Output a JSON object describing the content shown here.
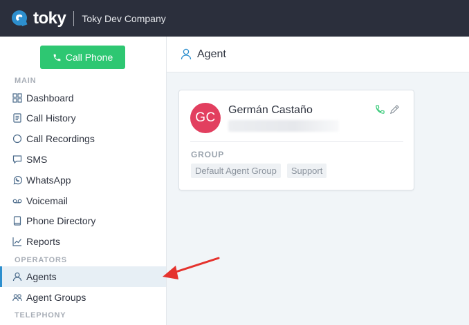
{
  "topbar": {
    "logo_text": "toky",
    "company": "Toky Dev Company"
  },
  "sidebar": {
    "call_button": "Call Phone",
    "sections": {
      "main": "MAIN",
      "operators": "OPERATORS",
      "telephony": "TELEPHONY"
    },
    "items": [
      {
        "label": "Dashboard",
        "icon": "dashboard-icon"
      },
      {
        "label": "Call History",
        "icon": "call-history-icon"
      },
      {
        "label": "Call Recordings",
        "icon": "call-recordings-icon"
      },
      {
        "label": "SMS",
        "icon": "sms-icon"
      },
      {
        "label": "WhatsApp",
        "icon": "whatsapp-icon"
      },
      {
        "label": "Voicemail",
        "icon": "voicemail-icon"
      },
      {
        "label": "Phone Directory",
        "icon": "phone-directory-icon"
      },
      {
        "label": "Reports",
        "icon": "reports-icon"
      },
      {
        "label": "Agents",
        "icon": "agent-icon",
        "active": true
      },
      {
        "label": "Agent Groups",
        "icon": "agent-groups-icon"
      }
    ]
  },
  "header": {
    "title": "Agent"
  },
  "agent_card": {
    "initials": "GC",
    "name": "Germán Castaño",
    "group_label": "GROUP",
    "groups": [
      "Default Agent Group",
      "Support"
    ]
  },
  "colors": {
    "topbar": "#2b2f3c",
    "accent_green": "#2ec772",
    "active_border": "#2d8fce",
    "avatar": "#e23f5f",
    "annotation_arrow": "#e5322d"
  }
}
